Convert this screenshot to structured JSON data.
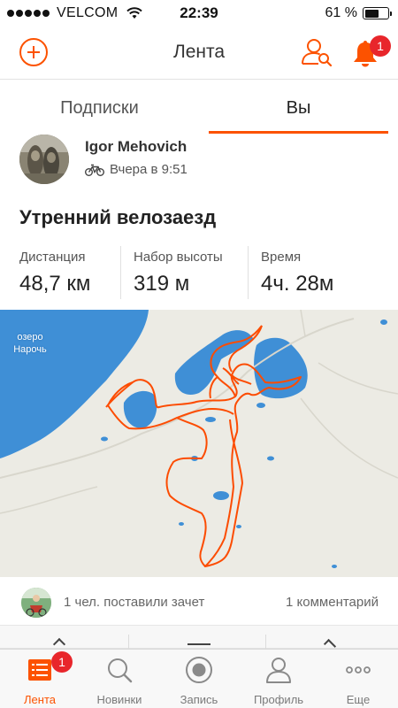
{
  "status_bar": {
    "carrier": "VELCOM",
    "time": "22:39",
    "battery_percent": "61 %",
    "battery_level": 0.61
  },
  "nav": {
    "title": "Лента",
    "notification_count": "1"
  },
  "tabs": [
    {
      "label": "Подписки",
      "active": false
    },
    {
      "label": "Вы",
      "active": true
    }
  ],
  "activity": {
    "athlete_name": "Igor Mehovich",
    "activity_type_icon": "bike-icon",
    "time_label": "Вчера в 9:51",
    "title": "Утренний велозаезд",
    "stats": [
      {
        "label": "Дистанция",
        "value": "48,7 км"
      },
      {
        "label": "Набор высоты",
        "value": "319 м"
      },
      {
        "label": "Время",
        "value": "4ч. 28м"
      }
    ],
    "map": {
      "label_lake": "озеро\nНарочь",
      "route_color": "#fc4c02",
      "water_color": "#3f8fd6"
    },
    "kudos_text": "1 чел. поставили зачет",
    "comments_text": "1 комментарий"
  },
  "tab_bar": {
    "items": [
      {
        "label": "Лента",
        "icon": "feed-icon",
        "active": true,
        "badge": "1"
      },
      {
        "label": "Новинки",
        "icon": "search-icon",
        "active": false
      },
      {
        "label": "Запись",
        "icon": "record-icon",
        "active": false
      },
      {
        "label": "Профиль",
        "icon": "profile-icon",
        "active": false
      },
      {
        "label": "Еще",
        "icon": "more-icon",
        "active": false
      }
    ]
  },
  "colors": {
    "accent": "#fc5200",
    "badge": "#e8262b"
  }
}
